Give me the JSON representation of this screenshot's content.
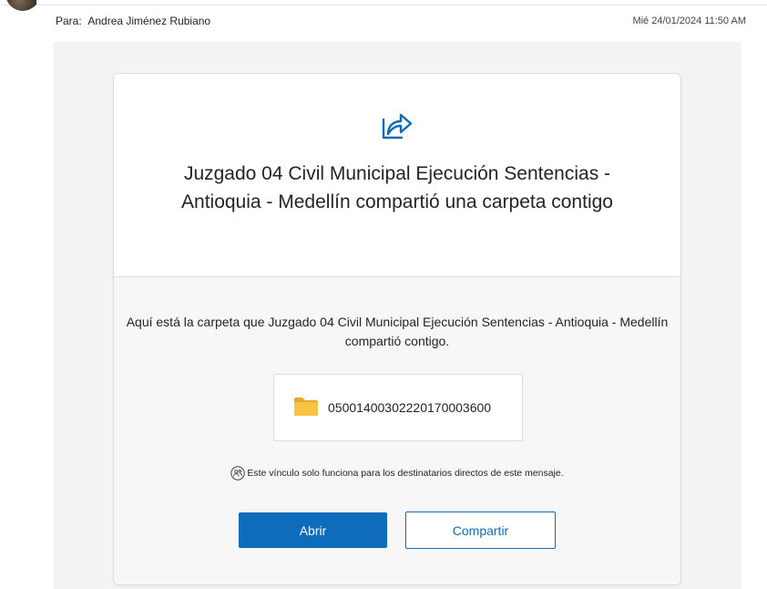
{
  "header": {
    "to_label": "Para:",
    "recipient": "Andrea Jiménez Rubiano",
    "date": "Mié 24/01/2024 11:50 AM"
  },
  "card": {
    "share_icon": "share-arrow-icon",
    "title": "Juzgado 04 Civil Municipal Ejecución Sentencias - Antioquia - Medellín compartió una carpeta contigo",
    "description": "Aquí está la carpeta que Juzgado 04 Civil Municipal Ejecución Sentencias - Antioquia - Medellín compartió contigo.",
    "folder": {
      "icon": "folder-icon",
      "name": "05001400302220170003600"
    },
    "notice": {
      "icon": "people-icon",
      "text": "Este vínculo solo funciona para los destinatarios directos de este mensaje."
    },
    "buttons": {
      "open_label": "Abrir",
      "share_label": "Compartir"
    }
  },
  "colors": {
    "accent": "#0f6cbd",
    "folder": "#f6c342",
    "card_background": "#f7f7f7",
    "body_background": "#f3f3f3"
  }
}
